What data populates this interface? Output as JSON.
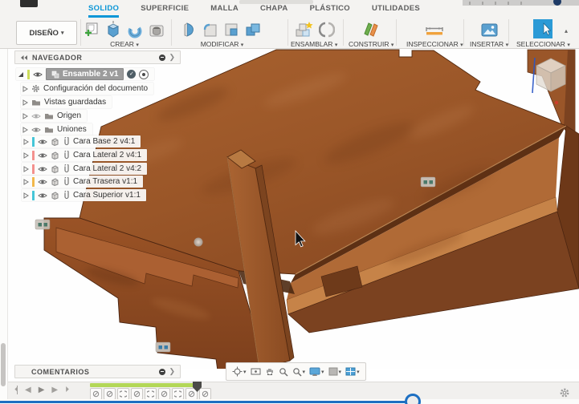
{
  "tabs": [
    {
      "label": "SOLIDO",
      "active": true
    },
    {
      "label": "SUPERFICIE",
      "active": false
    },
    {
      "label": "MALLA",
      "active": false
    },
    {
      "label": "CHAPA",
      "active": false
    },
    {
      "label": "PLÁSTICO",
      "active": false
    },
    {
      "label": "UTILIDADES",
      "active": false
    }
  ],
  "ribbon": {
    "design_menu_label": "DISEÑO",
    "groups": {
      "crear": "CREAR",
      "modificar": "MODIFICAR",
      "ensamblar": "ENSAMBLAR",
      "construir": "CONSTRUIR",
      "inspeccionar": "INSPECCIONAR",
      "insertar": "INSERTAR",
      "seleccionar": "SELECCIONAR"
    },
    "icon_names": [
      "create-sketch",
      "extrude",
      "revolve",
      "hole",
      "press-pull",
      "fillet",
      "shell",
      "combine",
      "new-component",
      "joint",
      "construction-plane",
      "measure",
      "insert-image",
      "select-cursor"
    ]
  },
  "navigator": {
    "title": "NAVEGADOR",
    "root": {
      "label": "Ensamble 2 v1",
      "bar_color": "#cddc5a"
    },
    "items": [
      {
        "label": "Configuración del documento",
        "icon": "gear"
      },
      {
        "label": "Vistas guardadas",
        "icon": "folder"
      },
      {
        "label": "Origen",
        "icon": "folder"
      },
      {
        "label": "Uniones",
        "icon": "folder"
      },
      {
        "label": "Cara Base 2 v4:1",
        "icon": "body",
        "bar_color": "#45c6d8"
      },
      {
        "label": "Cara Lateral 2 v4:1",
        "icon": "body",
        "bar_color": "#f4918e"
      },
      {
        "label": "Cara Lateral 2 v4:2",
        "icon": "body",
        "bar_color": "#f4918e"
      },
      {
        "label": "Cara Trasera v1:1",
        "icon": "body",
        "bar_color": "#f2b84b"
      },
      {
        "label": "Cara Superior v1:1",
        "icon": "body",
        "bar_color": "#45c6d8"
      }
    ]
  },
  "comments": {
    "title": "COMENTARIOS"
  },
  "view_toolbar": {
    "icons": [
      "orbit",
      "look-at",
      "pan",
      "zoom",
      "fit",
      "display-settings",
      "grid-settings",
      "viewports"
    ]
  },
  "timeline": {
    "ops": [
      "body",
      "body",
      "joint",
      "body",
      "joint",
      "body",
      "joint",
      "body",
      "body"
    ]
  },
  "scene": {
    "description_icons": [
      "view-cube",
      "joint-glyph-badge",
      "joint-origin-sphere",
      "mouse-cursor"
    ]
  },
  "colors": {
    "accent_blue": "#0a96d7",
    "wood_mid": "#9c5b2d",
    "wood_dark": "#5d3014",
    "wood_light": "#c68348",
    "timeline_green": "#b3d757",
    "player_blue": "#1d6fc2"
  }
}
